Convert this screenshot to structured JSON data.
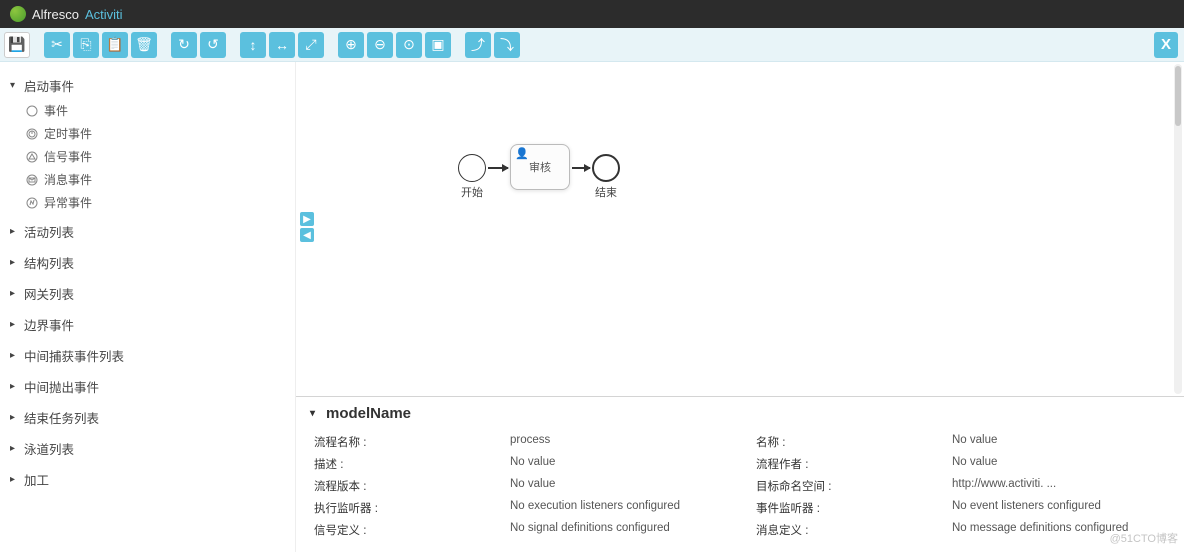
{
  "brand": {
    "name1": "Alfresco",
    "name2": "Activiti"
  },
  "toolbar": {
    "buttons": [
      {
        "name": "save-icon",
        "glyph": "💾",
        "cls": "save"
      },
      {
        "sep": true
      },
      {
        "name": "cut-icon",
        "glyph": "✂"
      },
      {
        "name": "copy-icon",
        "glyph": "⎘"
      },
      {
        "name": "paste-icon",
        "glyph": "📋"
      },
      {
        "name": "delete-icon",
        "glyph": "🗑"
      },
      {
        "sep": true
      },
      {
        "name": "redo-icon",
        "glyph": "↻"
      },
      {
        "name": "undo-icon",
        "glyph": "↺"
      },
      {
        "sep": true
      },
      {
        "name": "align-v-icon",
        "glyph": "↕"
      },
      {
        "name": "align-h-icon",
        "glyph": "↔"
      },
      {
        "name": "samesize-icon",
        "glyph": "⤢"
      },
      {
        "sep": true
      },
      {
        "name": "zoom-in-icon",
        "glyph": "⊕"
      },
      {
        "name": "zoom-out-icon",
        "glyph": "⊖"
      },
      {
        "name": "zoom-reset-icon",
        "glyph": "⊙"
      },
      {
        "name": "zoom-fit-icon",
        "glyph": "▣"
      },
      {
        "sep": true
      },
      {
        "name": "bend-add-icon",
        "glyph": "⤴"
      },
      {
        "name": "bend-remove-icon",
        "glyph": "⤵"
      }
    ],
    "close": "X"
  },
  "palette": {
    "groups": [
      {
        "label": "启动事件",
        "open": true,
        "items": [
          {
            "label": "事件",
            "icon": "circle"
          },
          {
            "label": "定时事件",
            "icon": "timer"
          },
          {
            "label": "信号事件",
            "icon": "signal"
          },
          {
            "label": "消息事件",
            "icon": "message"
          },
          {
            "label": "异常事件",
            "icon": "error"
          }
        ]
      },
      {
        "label": "活动列表",
        "open": false
      },
      {
        "label": "结构列表",
        "open": false
      },
      {
        "label": "网关列表",
        "open": false
      },
      {
        "label": "边界事件",
        "open": false
      },
      {
        "label": "中间捕获事件列表",
        "open": false
      },
      {
        "label": "中间抛出事件",
        "open": false
      },
      {
        "label": "结束任务列表",
        "open": false
      },
      {
        "label": "泳道列表",
        "open": false
      },
      {
        "label": "加工",
        "open": false
      }
    ]
  },
  "canvas_mini": {
    "up": "▶",
    "down": "◀"
  },
  "diagram": {
    "start": "开始",
    "task": "审核",
    "end": "结束"
  },
  "props": {
    "title": "modelName",
    "left": [
      {
        "label": "流程名称",
        "value": "process"
      },
      {
        "label": "描述",
        "value": "No value"
      },
      {
        "label": "流程版本",
        "value": "No value"
      },
      {
        "label": "执行监听器",
        "value": "No execution listeners configured"
      },
      {
        "label": "信号定义",
        "value": "No signal definitions configured"
      }
    ],
    "right": [
      {
        "label": "名称",
        "value": "No value"
      },
      {
        "label": "流程作者",
        "value": "No value"
      },
      {
        "label": "目标命名空间",
        "value": "http://www.activiti. ..."
      },
      {
        "label": "事件监听器",
        "value": "No event listeners configured"
      },
      {
        "label": "消息定义",
        "value": "No message definitions configured"
      }
    ]
  },
  "watermark": "@51CTO博客"
}
